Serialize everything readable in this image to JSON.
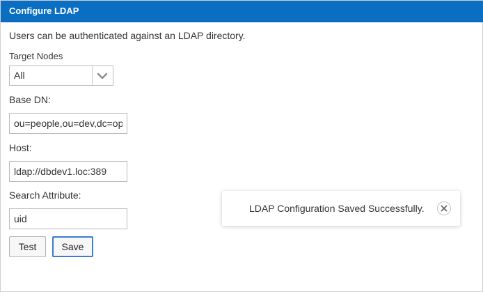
{
  "dialog": {
    "title": "Configure LDAP",
    "description": "Users can be authenticated against an LDAP directory."
  },
  "form": {
    "target_nodes_label": "Target Nodes",
    "target_nodes_value": "All",
    "base_dn_label": "Base DN:",
    "base_dn_value": "ou=people,ou=dev,dc=op",
    "host_label": "Host:",
    "host_value": "ldap://dbdev1.loc:389",
    "search_attribute_label": "Search Attribute:",
    "search_attribute_value": "uid"
  },
  "buttons": {
    "test_label": "Test",
    "save_label": "Save"
  },
  "toast": {
    "message": "LDAP Configuration Saved Successfully.",
    "close_icon": "close-icon"
  },
  "colors": {
    "titlebar": "#0a6fc2",
    "focus_border": "#3a7bd5"
  }
}
